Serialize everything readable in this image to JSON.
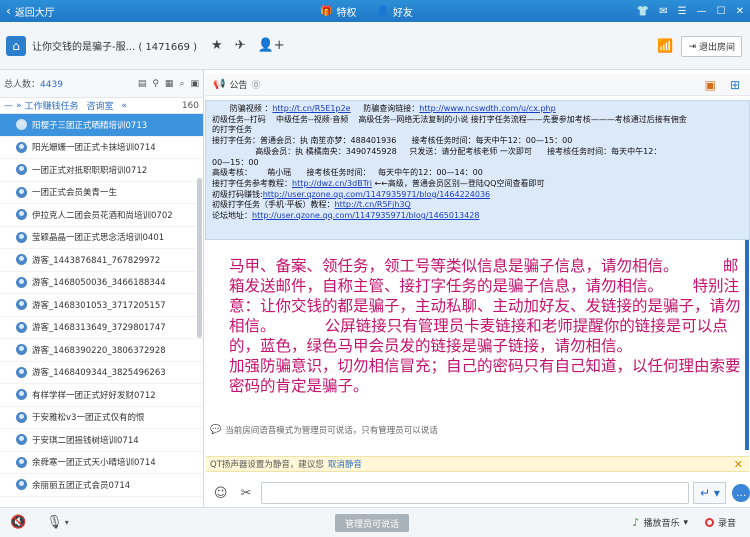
{
  "topbar": {
    "back_label": "返回大厅",
    "privilege_label": "特权",
    "friends_label": "好友"
  },
  "room": {
    "title": "让你交钱的是骗子-服...",
    "id": "( 1471669 )",
    "exit_label": "退出房间"
  },
  "left": {
    "total_label": "总人数：",
    "total_count": "4439",
    "tabs": [
      "工作赚钱任务",
      "咨询室"
    ],
    "count": "160",
    "users": [
      "阳樱子三团正式晒精培训0713",
      "阳光姗姗一团正式卡抹培训0714",
      "一团正式对抵职职职培训0712",
      "一团正式会员美青一生",
      "伊拉克人二团会员花酒和尚培训0702",
      "莹颖晶晶一团正式思念活培训0401",
      "游客_1443876841_767829972",
      "游客_1468050036_3466188344",
      "游客_1468301053_3717205157",
      "游客_1468313649_3729801747",
      "游客_1468390220_3806372928",
      "游客_1468409344_3825496263",
      "有样学样一团正式好好发财0712",
      "于安雅松v3一团正式仅有的恨",
      "于安琪二团摇钱树培训0714",
      "余舜寒一团正式天小晴培训0714",
      "余丽丽五团正式会员0714"
    ]
  },
  "notice": {
    "label": "公告",
    "lines": [
      {
        "parts": [
          {
            "t": "       防骗视频 ："
          },
          {
            "t": "http://t.cn/R5E1p2e",
            "link": true
          },
          {
            "t": "     防骗查询链接："
          },
          {
            "t": "http://www.ncswdth.com/u/cx.php",
            "link": true
          }
        ]
      },
      {
        "parts": [
          {
            "t": "初级任务--打码    中级任务--视频·音频    高级任务--网络无法复制的小说 接打字任务流程——先要参加考核———考核通过后接有佣金"
          }
        ]
      },
      {
        "parts": [
          {
            "t": "的打字任务"
          }
        ]
      },
      {
        "parts": [
          {
            "t": "接打字任务：普通会员：执 南笙亦梦：488401936      接考核任务时间：每天中午12：00—15：00"
          }
        ]
      },
      {
        "parts": [
          {
            "t": "                 高级会员：执 橘橘南央：3490745928     只发送：请分配考核老师 一次即可      接考核任务时间：每天中午12："
          }
        ]
      },
      {
        "parts": [
          {
            "t": "00—15：00"
          }
        ]
      },
      {
        "parts": [
          {
            "t": "高级考核：      萌小瑶      接考核任务时间：   每天中午的12：00—14：00"
          }
        ]
      },
      {
        "parts": [
          {
            "t": "接打字任务参考教程："
          },
          {
            "t": "http://dwz.cn/3dBTri",
            "link": true
          },
          {
            "t": " ←←高级，普通会员区别—登陆QQ空间查看即可"
          }
        ]
      },
      {
        "parts": [
          {
            "t": "初级打码赚钱:"
          },
          {
            "t": "http://user.qzone.qq.com/1147935971/blog/1464224036",
            "link": true
          }
        ]
      },
      {
        "parts": [
          {
            "t": "初级打字任务（手机·平板）教程："
          },
          {
            "t": "http://t.cn/R5Fjh3Q",
            "link": true
          }
        ]
      },
      {
        "parts": [
          {
            "t": "论坛地址："
          },
          {
            "t": "http://user.qzone.qq.com/1147935971/blog/1465013428",
            "link": true
          }
        ]
      }
    ]
  },
  "chat": {
    "big_text": "马甲、备案、领任务，领工号等类似信息是骗子信息，请勿相信。         邮箱发送邮件，自称主管、接打字任务的是骗子信息，请勿相信。      特别注意：让你交钱的都是骗子，主动私聊、主动加好友、发链接的是骗子，请勿相信。          公屏链接只有管理员卡麦链接和老师提醒你的链接是可以点的，蓝色，绿色马甲会员发的链接是骗子链接，请勿相信。\n加强防骗意识，切勿相信冒充；自己的密码只有自己知道，以任何理由索要密码的肯定是骗子。",
    "system_note": "当前房间语音模式为管理员可说话，只有管理员可以说话"
  },
  "warn": {
    "text": "QT扬声器设置为静音，建议您",
    "action": "取消静音"
  },
  "input": {
    "value": "",
    "placeholder": ""
  },
  "bottom": {
    "speak_label": "管理员可说话",
    "music_label": "播放音乐",
    "record_label": "录音"
  }
}
